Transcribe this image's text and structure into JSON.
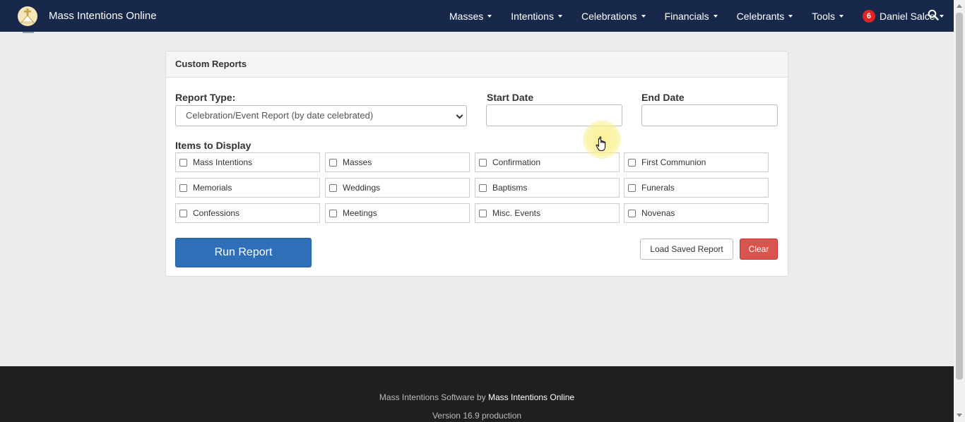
{
  "navbar": {
    "brand_title": "Mass Intentions Online",
    "menu": [
      {
        "label": "Masses"
      },
      {
        "label": "Intentions"
      },
      {
        "label": "Celebrations"
      },
      {
        "label": "Financials"
      },
      {
        "label": "Celebrants"
      },
      {
        "label": "Tools"
      }
    ],
    "user": {
      "name": "Daniel Salce",
      "notification_count": "6"
    },
    "search_icon": "search-icon",
    "brand_icon": "church-logo-icon",
    "bg_color": "#17284a",
    "badge_color": "#e02424"
  },
  "panel": {
    "heading": "Custom Reports",
    "report_type_label": "Report Type:",
    "report_type_value": "Celebration/Event Report (by date celebrated)",
    "start_date_label": "Start Date",
    "start_date_value": "",
    "end_date_label": "End Date",
    "end_date_value": "",
    "items_label": "Items to Display",
    "items": [
      {
        "label": "Mass Intentions",
        "checked": false
      },
      {
        "label": "Masses",
        "checked": false
      },
      {
        "label": "Confirmation",
        "checked": false
      },
      {
        "label": "First Communion",
        "checked": false
      },
      {
        "label": "Memorials",
        "checked": false
      },
      {
        "label": "Weddings",
        "checked": false
      },
      {
        "label": "Baptisms",
        "checked": false
      },
      {
        "label": "Funerals",
        "checked": false
      },
      {
        "label": "Confessions",
        "checked": false
      },
      {
        "label": "Meetings",
        "checked": false
      },
      {
        "label": "Misc. Events",
        "checked": false
      },
      {
        "label": "Novenas",
        "checked": false
      }
    ],
    "run_button": "Run Report",
    "load_button": "Load Saved Report",
    "clear_button": "Clear",
    "primary_color": "#2f6fb8",
    "danger_color": "#d9534f"
  },
  "footer": {
    "line1_prefix": "Mass Intentions Software by",
    "line1_strong": "Mass Intentions Online",
    "line2": "Version 16.9 production"
  }
}
